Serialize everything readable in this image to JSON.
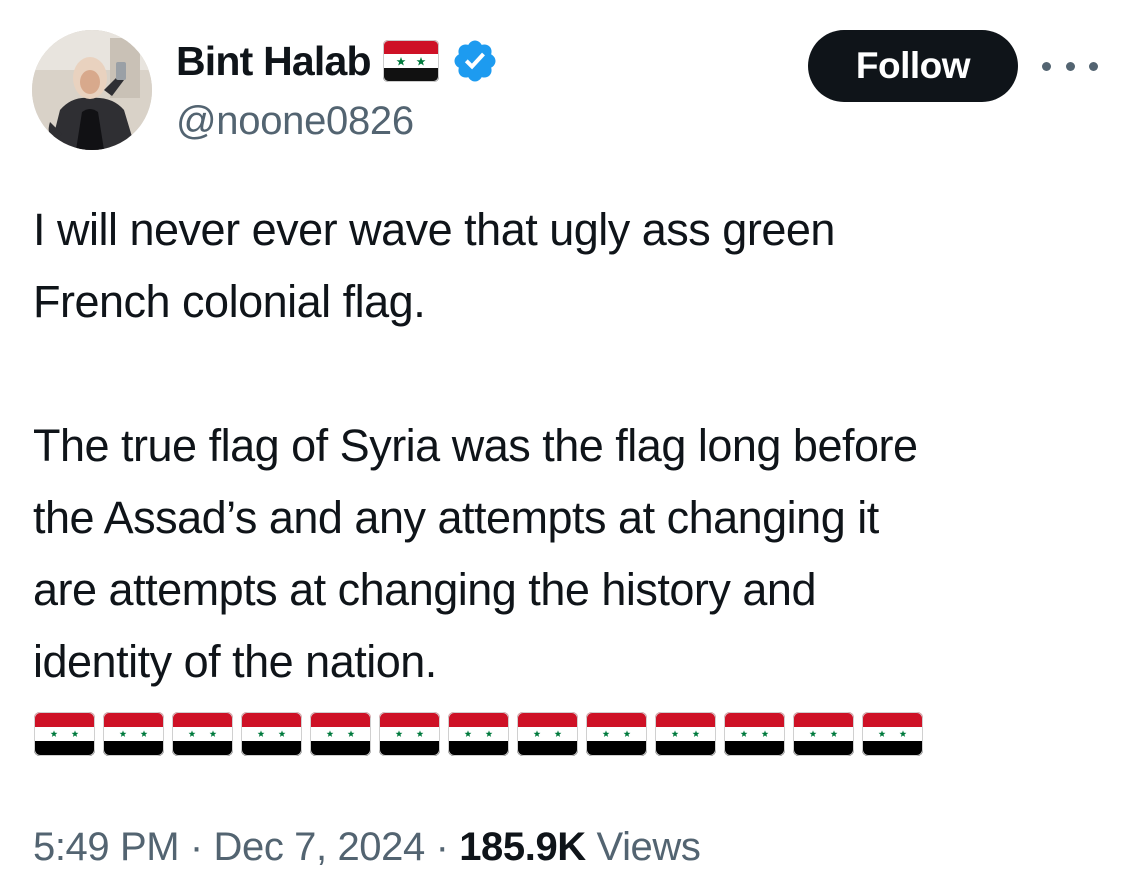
{
  "author": {
    "display_name": "Bint Halab",
    "handle": "@noone0826",
    "verified": true,
    "name_emoji": "syria-flag-icon"
  },
  "follow_button": {
    "label": "Follow"
  },
  "more_menu": {
    "icon": "more-options-icon"
  },
  "tweet": {
    "lines": [
      "I will never ever wave that ugly ass green",
      "French colonial flag.",
      "",
      "The true flag of Syria was the flag long before",
      "the Assad’s and any attempts at changing it",
      "are attempts at changing the history and",
      "identity of the nation."
    ],
    "flag_emoji_count": 13,
    "flag_emoji": "syria-flag-icon"
  },
  "meta": {
    "time": "5:49 PM",
    "separator": "·",
    "date": "Dec 7, 2024",
    "views_count": "185.9K",
    "views_label": "Views"
  },
  "colors": {
    "text_primary": "#0f1419",
    "text_secondary": "#536471",
    "verified_blue": "#1d9bf0",
    "flag_red": "#ce1126",
    "flag_white": "#ffffff",
    "flag_black": "#000000",
    "flag_green": "#007a3d"
  }
}
